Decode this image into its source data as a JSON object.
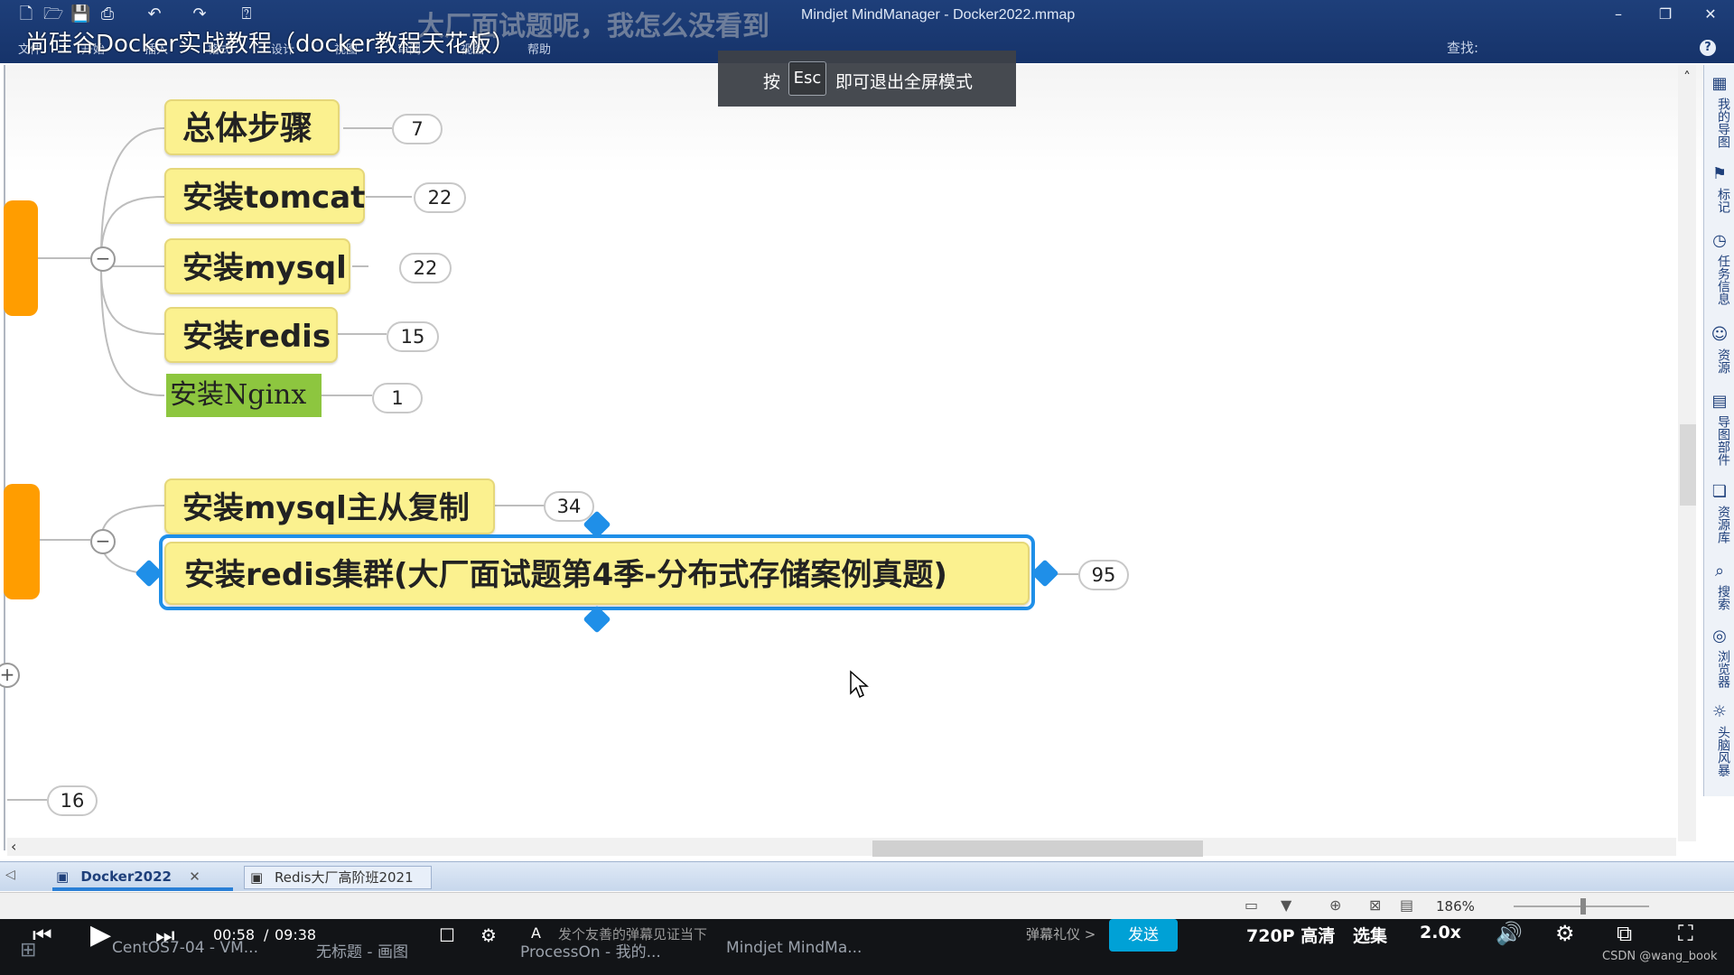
{
  "window": {
    "app_title": "Mindjet MindManager - Docker2022.mmap",
    "overlay_title": "尚硅谷Docker实战教程（docker教程天花板）",
    "danmaku": "大厂面试题呢，我怎么没看到",
    "menu": [
      "文件",
      "开始",
      "插入",
      "格式",
      "设计",
      "视图",
      "审阅",
      "视图",
      "帮助"
    ],
    "search_label": "查找:",
    "help": "?"
  },
  "esc_notice": {
    "prefix": "按",
    "key": "Esc",
    "suffix": "即可退出全屏模式"
  },
  "mindmap": {
    "group1": [
      {
        "label": "总体步骤",
        "count": "7"
      },
      {
        "label": "安装tomcat",
        "count": "22"
      },
      {
        "label": "安装mysql",
        "count": "22"
      },
      {
        "label": "安装redis",
        "count": "15"
      },
      {
        "label": "安装Nginx",
        "count": "1"
      }
    ],
    "group2": [
      {
        "label": "安装mysql主从复制",
        "count": "34"
      },
      {
        "label": "安装redis集群(大厂面试题第4季-分布式存储案例真题)",
        "count": "95"
      }
    ],
    "other_count": "16",
    "collapse_symbol": "−",
    "expand_symbol": "+"
  },
  "right_pane": [
    "我的导图",
    "标记",
    "任务信息",
    "资源",
    "导图部件",
    "资源库",
    "搜索",
    "浏览器",
    "头脑风暴"
  ],
  "doc_tabs": [
    {
      "label": "Docker2022",
      "active": true
    },
    {
      "label": "Redis大厂高阶班2021",
      "active": false
    }
  ],
  "status": {
    "zoom": "186%"
  },
  "video": {
    "time_current": "00:58",
    "time_separator": "/",
    "time_total": "09:38",
    "danmaku_placeholder": "发个友善的弹幕见证当下",
    "danmaku_etiquette": "弹幕礼仪 >",
    "send": "发送",
    "quality": "720P 高清",
    "episodes": "选集",
    "speed": "2.0x",
    "watermark": "CSDN @wang_book"
  },
  "taskbar": [
    "CentOS7-04 - VM...",
    "无标题 - 画图",
    "ProcessOn - 我的...",
    "Mindjet MindMa..."
  ],
  "colors": {
    "titlebar": "#1e3f7a",
    "topic_fill": "#fbf18f",
    "nginx_fill": "#8dc63f",
    "selection": "#1f8fe8",
    "orange": "#ff9d00",
    "send": "#00a1d6"
  }
}
